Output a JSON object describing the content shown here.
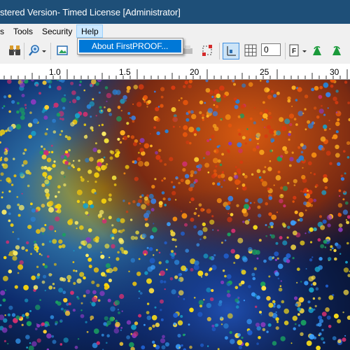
{
  "window": {
    "title": "stered Version- Timed License [Administrator]"
  },
  "menubar": {
    "items": [
      {
        "label": "s"
      },
      {
        "label": "Tools"
      },
      {
        "label": "Security"
      },
      {
        "label": "Help"
      }
    ]
  },
  "help_menu": {
    "items": [
      {
        "label": "About FirstPROOF..."
      }
    ]
  },
  "toolbar": {
    "field_value": "0",
    "icons": [
      "find-icon",
      "zoom-icon",
      "image-icon",
      "print-icon",
      "frame-icon",
      "grid-view-icon",
      "font-icon",
      "rotate-left-icon",
      "rotate-right-icon"
    ]
  },
  "ruler": {
    "labels": [
      "1.0",
      "1.5",
      "20",
      "25",
      "30"
    ]
  },
  "colors": {
    "titlebar": "#1e4f78",
    "menu_highlight": "#cce8ff",
    "selection": "#0078d7",
    "accent_green": "#1a9a3a"
  }
}
